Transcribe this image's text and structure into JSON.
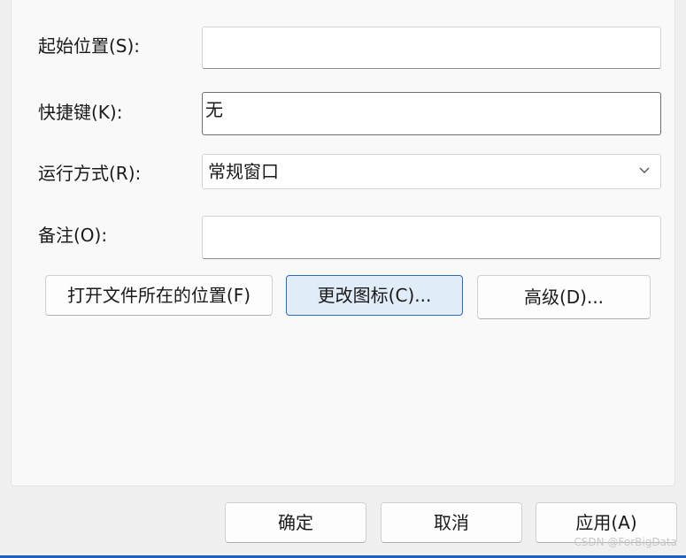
{
  "form": {
    "start_in": {
      "label": "起始位置(S):",
      "value": ""
    },
    "shortcut_key": {
      "label": "快捷键(K):",
      "value": "无"
    },
    "run": {
      "label": "运行方式(R):",
      "value": "常规窗口",
      "icon": "chevron-down-icon"
    },
    "comment": {
      "label": "备注(O):",
      "value": ""
    }
  },
  "actions": {
    "open_location": "打开文件所在的位置(F)",
    "change_icon": "更改图标(C)...",
    "advanced": "高级(D)..."
  },
  "footer": {
    "ok": "确定",
    "cancel": "取消",
    "apply": "应用(A)"
  },
  "watermark": "CSDN @ForBigData",
  "colors": {
    "accent": "#2b6cb8",
    "primary_button_bg": "#e0ecf8",
    "panel_bg": "#f9f9f9",
    "window_bg": "#f0f0f0",
    "taskbar_edge": "#1f5fbf"
  }
}
